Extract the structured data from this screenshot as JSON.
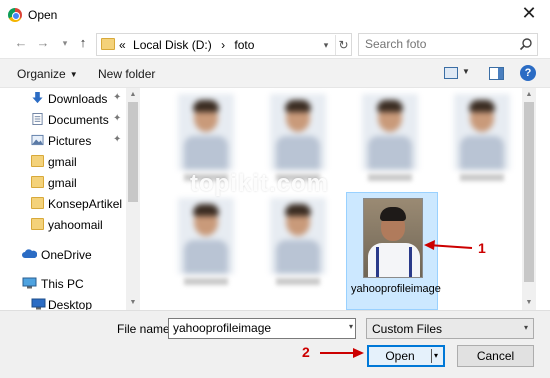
{
  "window": {
    "title": "Open",
    "close_glyph": "✕",
    "app_icon": "chrome-icon"
  },
  "nav": {
    "back_glyph": "←",
    "forward_glyph": "→",
    "recent_glyph": "▾",
    "up_glyph": "↑",
    "address": {
      "prefix": "«",
      "path": [
        "Local Disk (D:)",
        "foto"
      ],
      "separator": "›",
      "dropdown_glyph": "▾",
      "refresh_glyph": "↻"
    },
    "search": {
      "placeholder": "Search foto"
    }
  },
  "commands": {
    "organize": "Organize",
    "organize_caret": "▼",
    "new_folder": "New folder",
    "view_caret": "▼",
    "help": "?"
  },
  "sidebar": {
    "items": [
      {
        "label": "Downloads",
        "icon": "download-icon",
        "pinned": true
      },
      {
        "label": "Documents",
        "icon": "documents-icon",
        "pinned": true
      },
      {
        "label": "Pictures",
        "icon": "pictures-icon",
        "pinned": true
      },
      {
        "label": "gmail",
        "icon": "folder-icon",
        "pinned": false
      },
      {
        "label": "gmail",
        "icon": "folder-icon",
        "pinned": false
      },
      {
        "label": "KonsepArtikel",
        "icon": "folder-icon",
        "pinned": false
      },
      {
        "label": "yahoomail",
        "icon": "folder-icon",
        "pinned": false
      },
      {
        "label": "OneDrive",
        "icon": "onedrive-icon",
        "pinned": false
      },
      {
        "label": "This PC",
        "icon": "computer-icon",
        "pinned": false
      },
      {
        "label": "Desktop",
        "icon": "desktop-icon",
        "pinned": false
      }
    ],
    "pin_glyph": "📌",
    "scroll_up": "▲",
    "scroll_down": "▼"
  },
  "content": {
    "selected_file": "yahooprofileimage",
    "watermark": "topikit.com"
  },
  "footer": {
    "file_name_label": "File name:",
    "file_name_value": "yahooprofileimage",
    "file_type": "Custom Files",
    "open_label": "Open",
    "cancel_label": "Cancel",
    "dropdown_glyph": "▾"
  },
  "annotations": {
    "marker1": "1",
    "marker2": "2",
    "color": "#cc0000"
  }
}
